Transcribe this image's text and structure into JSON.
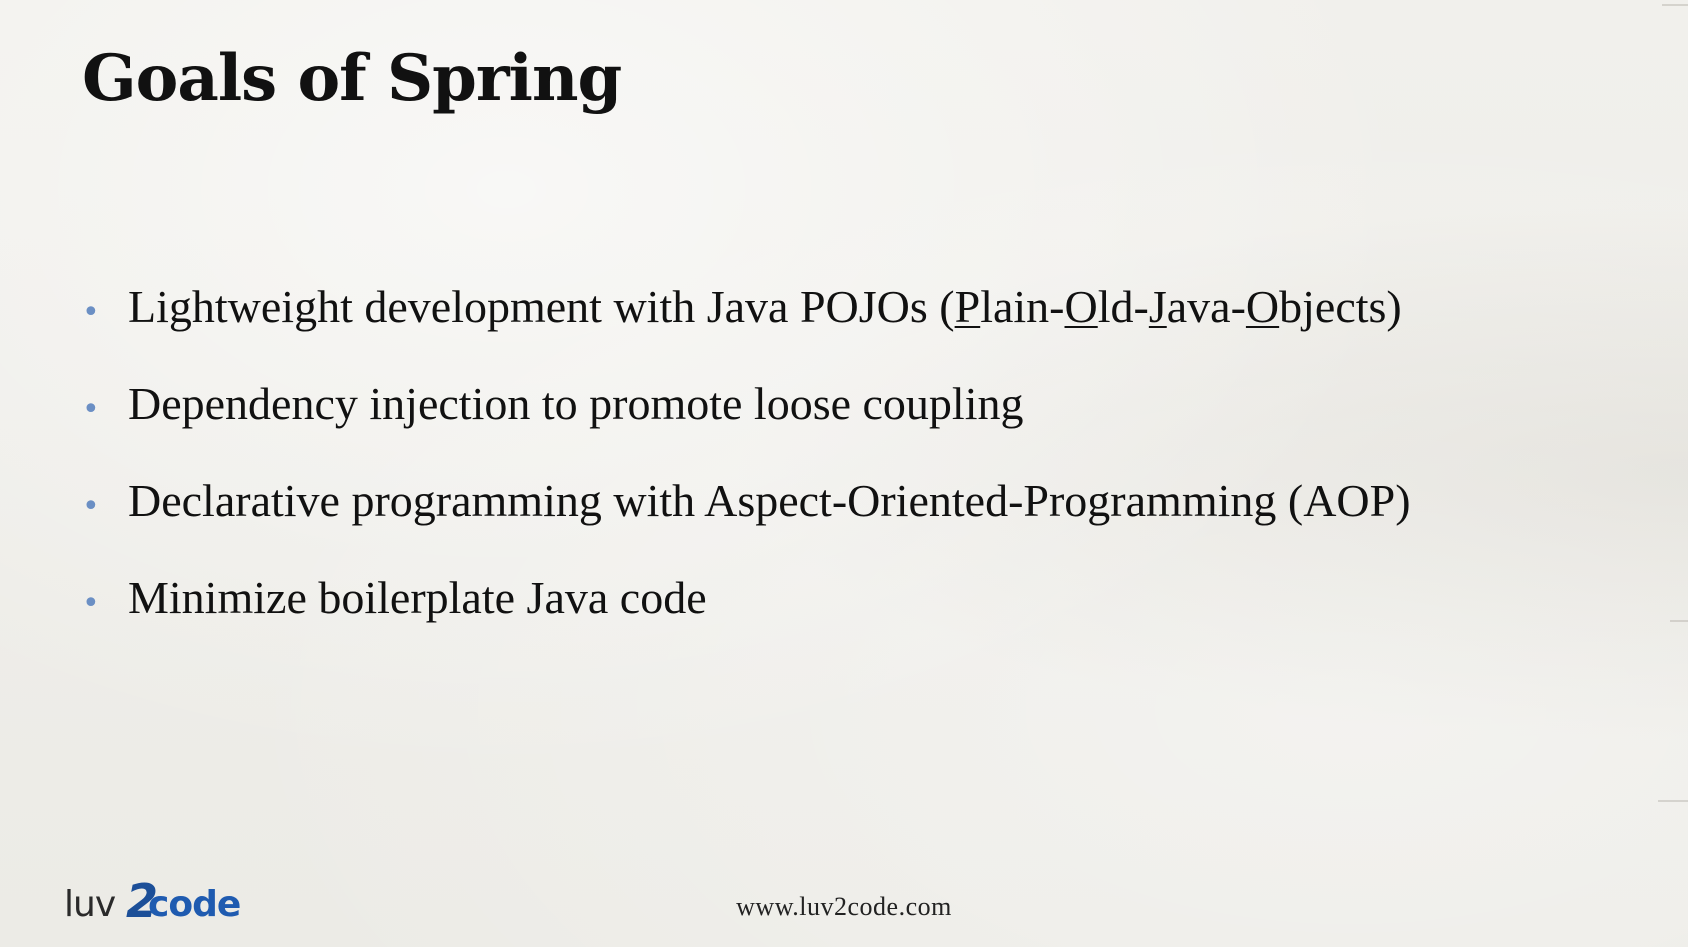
{
  "slide": {
    "title": "Goals of Spring",
    "bullets": [
      {
        "text": "Lightweight development with Java POJOs (Plain-Old-Java-Objects)",
        "parts": {
          "before": "Lightweight development with Java POJOs (",
          "p": "P",
          "lain": "lain-",
          "o1": "O",
          "ld": "ld-",
          "j": "J",
          "ava": "ava-",
          "o2": "O",
          "bjects": "bjects)"
        }
      },
      {
        "text": "Dependency injection to promote loose coupling"
      },
      {
        "text": "Declarative programming with Aspect-Oriented-Programming (AOP)"
      },
      {
        "text": "Minimize boilerplate Java code"
      }
    ],
    "bullet_symbol": "•",
    "bullet_color": "#6b8fc4"
  },
  "footer": {
    "logo": {
      "part1": "luv",
      "part2": "2",
      "part3": "code",
      "brand_color": "#1f5bb0"
    },
    "url": "www.luv2code.com"
  }
}
